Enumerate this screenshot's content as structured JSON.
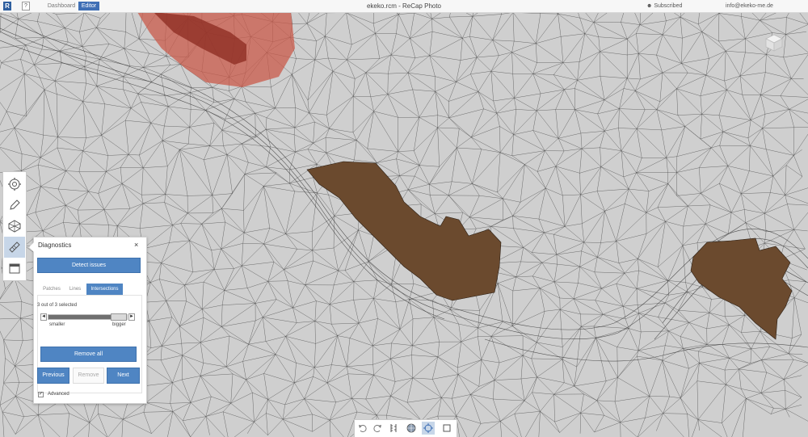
{
  "window": {
    "title": "ekeko.rcm - ReCap Photo"
  },
  "topbar": {
    "logo": "R",
    "help": "?",
    "tabs": [
      {
        "label": "Dashboard"
      },
      {
        "label": "Editor"
      }
    ],
    "subscription": "Subscribed",
    "user": "info@ekeko-me.de"
  },
  "left_toolbar": {
    "tools": [
      {
        "icon": "settings-icon"
      },
      {
        "icon": "pencil-icon"
      },
      {
        "icon": "mesh-icon"
      },
      {
        "icon": "diagnostics-icon",
        "active": true
      },
      {
        "icon": "frame-icon"
      }
    ]
  },
  "diagnostics": {
    "title": "Diagnostics",
    "close": "×",
    "detect_label": "Detect issues",
    "tabs": [
      {
        "label": "Patches"
      },
      {
        "label": "Lines"
      },
      {
        "label": "Intersections",
        "active": true
      }
    ],
    "selection_text": "3 out of 3 selected",
    "slider": {
      "left_arrow": "◄",
      "right_arrow": "►",
      "min_label": "smaller",
      "max_label": "bigger",
      "value": 1.0
    },
    "remove_all_label": "Remove all",
    "prev_label": "Previous",
    "remove_label": "Remove",
    "next_label": "Next",
    "advanced_checkbox": "✓",
    "advanced_label": "Advanced"
  },
  "bottom_toolbar": {
    "tools": [
      {
        "icon": "undo-icon"
      },
      {
        "icon": "redo-icon"
      },
      {
        "icon": "ruler-icon"
      },
      {
        "icon": "shading-icon"
      },
      {
        "icon": "orbit-icon",
        "active": true
      },
      {
        "icon": "crop-icon"
      }
    ]
  },
  "colors": {
    "accent": "#4f85c3",
    "surface": "#cfcfcf",
    "mesh_lines": "#2a2a2a",
    "selected_region": "#6b4a2e",
    "highlight_region": "#c9594a"
  }
}
